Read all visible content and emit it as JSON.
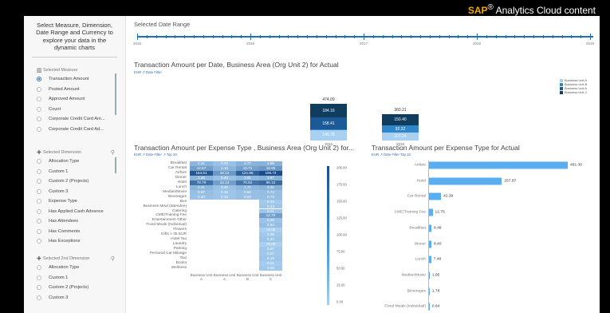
{
  "brand": {
    "sap": "SAP",
    "mark": "®",
    "product": "Analytics Cloud content"
  },
  "left_panel": {
    "intro": "Select Measure, Dimension, Date Range and Currency to explore your data in the dynamic charts",
    "measure": {
      "header": "Selected Measure",
      "items": [
        "Transaction Amount",
        "Posted Amount",
        "Approved Amount",
        "Count",
        "Corporate Credit Card Am...",
        "Corporate Credit Card Ad..."
      ],
      "selected": 0
    },
    "dimension": {
      "header": "Selected Dimension",
      "items": [
        "Allocation Type",
        "Custom 1",
        "Custom 2 (Projects)",
        "Custom 3",
        "Expense Type",
        "Has Applied Cash Advance",
        "Has Attendees",
        "Has Comments",
        "Has Exceptions"
      ]
    },
    "dimension2": {
      "header": "Selected 2nd Dimension",
      "items": [
        "Allocation Type",
        "Custom 1",
        "Custom 2 (Projects)",
        "Custom 3"
      ]
    }
  },
  "date_range": {
    "title": "Selected Date Range",
    "years": [
      "2015",
      "2016",
      "2017",
      "2018",
      "2019"
    ]
  },
  "chart1": {
    "title": "Transaction Amount per Date, Business Area (Org Unit 2) for Actual",
    "subtitle": "EUR  ↗ Date Filter",
    "legend": [
      {
        "name": "Business Unit A",
        "color": "#a9d0f1"
      },
      {
        "name": "Business Unit B",
        "color": "#2f86c9"
      },
      {
        "name": "Business Unit A",
        "color": "#1b5a96"
      },
      {
        "name": "Business Unit C",
        "color": "#103c5e"
      }
    ]
  },
  "chart_data": [
    {
      "type": "bar",
      "title": "Transaction Amount per Date, Business Area (Org Unit 2) for Actual",
      "stacked": true,
      "categories": [
        "2016",
        "2018"
      ],
      "totals": [
        "474.09",
        "360.21"
      ],
      "segments": [
        [
          {
            "value": 146.78,
            "label": "146.78",
            "color": "#a9d0f1"
          },
          {
            "value": 0.5,
            "label": "",
            "color": "#2f86c9"
          },
          {
            "value": 158.41,
            "label": "158.41",
            "color": "#1b5a96"
          },
          {
            "value": 184.16,
            "label": "184.16",
            "color": "#103c5e"
          }
        ],
        [
          {
            "value": 107.24,
            "label": "107.24",
            "color": "#a9d0f1"
          },
          {
            "value": 92.32,
            "label": "92.32",
            "color": "#2f86c9"
          },
          {
            "value": 150.4,
            "label": "150.40",
            "color": "#103c5e"
          }
        ]
      ]
    },
    {
      "type": "heatmap",
      "title": "Transaction Amount per Expense Type , Business Area (Org Unit 2) for...",
      "columns": [
        "Business Unit A",
        "Business Unit A",
        "Business Unit B",
        "Business Unit C"
      ],
      "rows": [
        {
          "label": "Breakfast",
          "cells": [
            "2.31",
            "0.43",
            "2.77",
            "2.96"
          ]
        },
        {
          "label": "Car Rental",
          "cells": [
            "12.57",
            "2.16",
            "10.71",
            "16.95"
          ]
        },
        {
          "label": "Airfare",
          "cells": [
            "154.61",
            "18.12",
            "121.86",
            "196.72"
          ]
        },
        {
          "label": "Dinner",
          "cells": [
            "2.46",
            "0.45",
            "1.81",
            "3.67"
          ]
        },
        {
          "label": "Hotel",
          "cells": [
            "78.79",
            "13.14",
            "70.82",
            "95.12"
          ]
        },
        {
          "label": "Lunch",
          "cells": [
            "2.31",
            "0.45",
            "1.71",
            "3.01"
          ]
        },
        {
          "label": "Median/Movie",
          "cells": [
            "0.57",
            "0.15",
            "0.52",
            "0.72"
          ]
        },
        {
          "label": "Beverages",
          "cells": [
            "0.40",
            "0.18",
            "0.53",
            "0.73"
          ]
        },
        {
          "label": "Bus",
          "cells": [
            "",
            "",
            "",
            "0.04"
          ]
        },
        {
          "label": "Business Meal (attendee)",
          "cells": [
            "",
            "",
            "",
            "0.13"
          ]
        },
        {
          "label": "Catering",
          "cells": [
            "",
            "",
            "",
            "0.21"
          ]
        },
        {
          "label": "CME/Training Fee",
          "cells": [
            "",
            "",
            "",
            "12.75"
          ]
        },
        {
          "label": "Entertainment Other",
          "cells": [
            "",
            "",
            "",
            "0.20"
          ]
        },
        {
          "label": "Fixed Meals (Individual)",
          "cells": [
            "",
            "",
            "",
            "0.64"
          ]
        },
        {
          "label": "Flowers",
          "cells": [
            "",
            "",
            "",
            "<0.00"
          ]
        },
        {
          "label": "Gifts > 35 EUR",
          "cells": [
            "",
            "",
            "",
            "0.08"
          ]
        },
        {
          "label": "Hotel Tax",
          "cells": [
            "",
            "",
            "",
            "0.24"
          ]
        },
        {
          "label": "Laundry",
          "cells": [
            "",
            "",
            "",
            "<0.00"
          ]
        },
        {
          "label": "Parking",
          "cells": [
            "",
            "",
            "",
            "0.07"
          ]
        },
        {
          "label": "Personal Car Mileage",
          "cells": [
            "",
            "",
            "",
            "0.07"
          ]
        },
        {
          "label": "Taxi",
          "cells": [
            "",
            "",
            "",
            "0.15"
          ]
        },
        {
          "label": "Books",
          "cells": [
            "",
            "",
            "",
            "0.01"
          ]
        },
        {
          "label": "Wellness",
          "cells": [
            "",
            "",
            "",
            "0.08"
          ]
        }
      ],
      "scale_ticks": [
        "200.00",
        "175.00",
        "150.00",
        "125.00",
        "100.00",
        "75.00",
        "50.00",
        "25.00",
        "0.00"
      ]
    },
    {
      "type": "bar",
      "orientation": "horizontal",
      "title": "Transaction Amount per Expense Type for Actual",
      "categories": [
        "Airfare",
        "Hotel",
        "Car Rental",
        "CME/Training Fee",
        "Breakfast",
        "Dinner",
        "Lunch",
        "Median/Movie",
        "Beverages",
        "Fixed Meals (Individual)"
      ],
      "values": [
        491.3,
        257.87,
        42.39,
        12.75,
        8.48,
        8.4,
        7.48,
        1.95,
        1.78,
        0.64
      ],
      "labels": [
        "491.30",
        "257.87",
        "42.39",
        "12.75",
        "8.48",
        "8.40",
        "7.48",
        "1.95",
        "1.78",
        "0.64"
      ]
    }
  ],
  "chart2": {
    "subtitle": "EUR  ↗ Date Filter  ↗ Top 10"
  },
  "chart3": {
    "subtitle": "EUR  ↗ Date Filter  Top 10"
  },
  "icons": {
    "measure": "bar-chart-icon",
    "dimension": "plus-icon",
    "search": "magnifier-icon"
  }
}
